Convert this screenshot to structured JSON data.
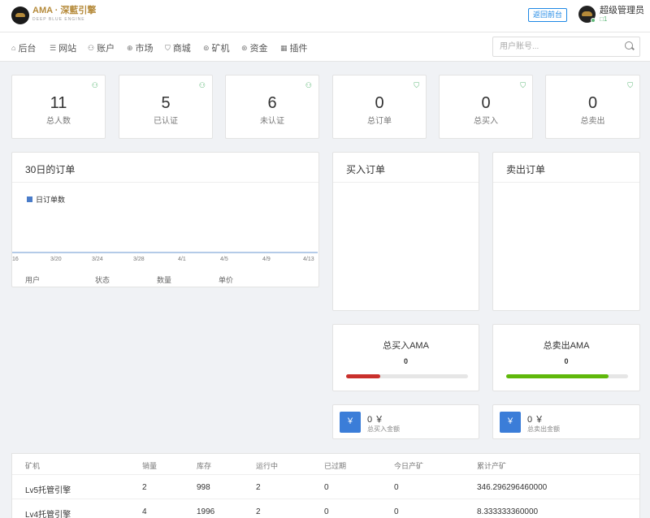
{
  "header": {
    "logo_text": "AMA · 深藍引擎",
    "logo_sub": "DEEP BLUE ENGINE",
    "back_label": "返回前台",
    "user_name": "超级管理员",
    "user_id": "□1"
  },
  "nav": {
    "items": [
      {
        "label": "后台",
        "icon": "home-icon"
      },
      {
        "label": "网站",
        "icon": "list-icon"
      },
      {
        "label": "账户",
        "icon": "user-icon"
      },
      {
        "label": "市场",
        "icon": "globe-icon"
      },
      {
        "label": "商城",
        "icon": "cart-icon"
      },
      {
        "label": "矿机",
        "icon": "miner-icon"
      },
      {
        "label": "资金",
        "icon": "money-icon"
      },
      {
        "label": "插件",
        "icon": "grid-icon"
      }
    ],
    "search_placeholder": "用户账号..."
  },
  "stats": [
    {
      "value": "11",
      "label": "总人数",
      "icon": "user-icon"
    },
    {
      "value": "5",
      "label": "已认证",
      "icon": "user-icon"
    },
    {
      "value": "6",
      "label": "未认证",
      "icon": "user-icon"
    },
    {
      "value": "0",
      "label": "总订单",
      "icon": "cart-icon"
    },
    {
      "value": "0",
      "label": "总买入",
      "icon": "cart-icon"
    },
    {
      "value": "0",
      "label": "总卖出",
      "icon": "cart-icon"
    }
  ],
  "orders_panel": {
    "title": "30日的订单",
    "legend": "日订单数",
    "ticks": [
      "16",
      "3/20",
      "3/24",
      "3/28",
      "4/1",
      "4/5",
      "4/9",
      "4/13"
    ],
    "columns": [
      "用户",
      "状态",
      "数量",
      "单价"
    ]
  },
  "buy_panel": {
    "title": "买入订单"
  },
  "sell_panel": {
    "title": "卖出订单"
  },
  "totals": {
    "buy": {
      "title": "总买入AMA",
      "value": "0",
      "progress": 0.28,
      "color": "#c9302c"
    },
    "sell": {
      "title": "总卖出AMA",
      "value": "0",
      "progress": 0.84,
      "color": "#5fb80a"
    }
  },
  "amounts": {
    "buy": {
      "value": "0 ￥",
      "label": "总买入金额",
      "symbol": "￥"
    },
    "sell": {
      "value": "0 ￥",
      "label": "总卖出金额",
      "symbol": "￥"
    }
  },
  "miner_table": {
    "columns": [
      "矿机",
      "销量",
      "库存",
      "运行中",
      "已过期",
      "今日产矿",
      "累计产矿"
    ],
    "rows": [
      [
        "Lv5托管引擎",
        "2",
        "998",
        "2",
        "0",
        "0",
        "346.296296460000"
      ],
      [
        "Lv4托管引擎",
        "4",
        "1996",
        "2",
        "0",
        "0",
        "8.333333360000"
      ]
    ]
  }
}
